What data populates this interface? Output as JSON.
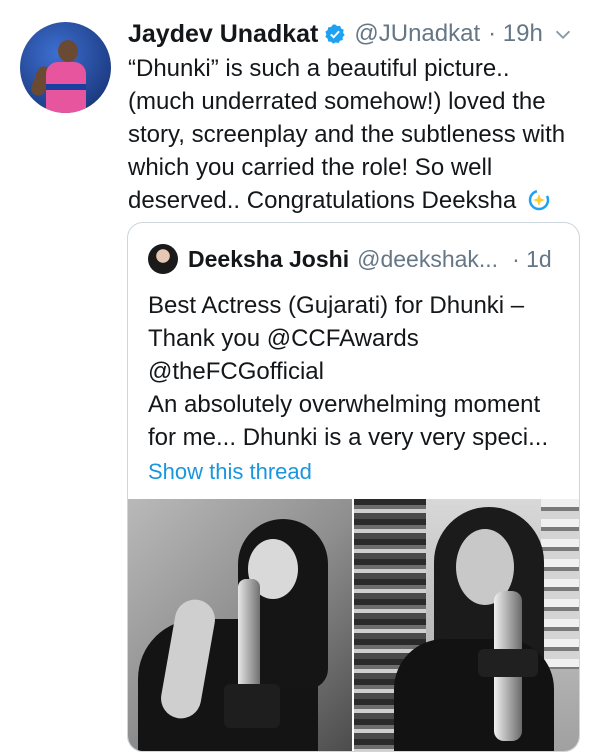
{
  "tweet": {
    "author_name": "Jaydev Unadkat",
    "handle": "@JUnadkat",
    "time": "· 19h",
    "lines": [
      "“Dhunki” is such a beautiful picture..",
      "(much underrated somehow!) loved the",
      "story, screenplay and the subtleness with",
      "which you carried the role! So well",
      "deserved.. Congratulations Deeksha"
    ]
  },
  "quote": {
    "author_name": "Deeksha Joshi",
    "handle": "@deekshak...",
    "time": "· 1d",
    "lines": [
      "Best Actress (Gujarati) for Dhunki –",
      "Thank you @CCFAwards",
      "@theFCGofficial",
      "An absolutely overwhelming moment",
      "for me... Dhunki is a very very speci..."
    ],
    "show_thread": "Show this thread"
  },
  "colors": {
    "link": "#1b95e0",
    "secondary_text": "#657786",
    "border": "#ccd6dd"
  },
  "icons": {
    "verified": "verified-badge-icon",
    "chevron": "chevron-down-icon",
    "sparkle": "sparkle-emoji-icon"
  }
}
